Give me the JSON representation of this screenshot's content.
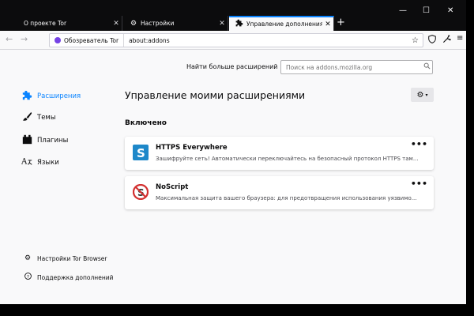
{
  "tabs": [
    {
      "label": "О проекте Tor",
      "close": "✕",
      "icon": ""
    },
    {
      "label": "Настройки",
      "close": "✕",
      "icon": "gear-icon"
    },
    {
      "label": "Управление дополнениями",
      "close": "✕",
      "icon": "puzzle-icon"
    }
  ],
  "active_tab": 2,
  "new_tab": "+",
  "window_controls": {
    "minimize": "—",
    "maximize": "☐",
    "close": "✕"
  },
  "navbar": {
    "identity_label": "Обозреватель Tor",
    "url": "about:addons"
  },
  "page": {
    "find_more_label": "Найти больше расширений",
    "search_placeholder": "Поиск на addons.mozilla.org",
    "heading": "Управление моими расширениями",
    "section_enabled": "Включено"
  },
  "sidebar": {
    "items": [
      {
        "label": "Расширения",
        "icon": "puzzle-icon",
        "selected": true
      },
      {
        "label": "Темы",
        "icon": "brush-icon",
        "selected": false
      },
      {
        "label": "Плагины",
        "icon": "plugin-icon",
        "selected": false
      },
      {
        "label": "Языки",
        "icon": "language-icon",
        "selected": false
      }
    ],
    "footer": [
      {
        "label": "Настройки Tor Browser",
        "icon": "gear-icon"
      },
      {
        "label": "Поддержка дополнений",
        "icon": "help-icon"
      }
    ]
  },
  "addons": [
    {
      "name": "HTTPS Everywhere",
      "description": "Зашифруйте сеть! Автоматически переключайтесь на безопасный протокол HTTPS там...",
      "icon": "https-everywhere-icon"
    },
    {
      "name": "NoScript",
      "description": "Максимальная защита вашего браузера: для предотвращения использования уязвимо...",
      "icon": "noscript-icon"
    }
  ],
  "colors": {
    "accent": "#0a84ff",
    "tabstrip": "#0c0c0d",
    "tor_purple": "#7542e5",
    "https_blue": "#1e88c9",
    "noscript_red": "#d32f2f"
  }
}
